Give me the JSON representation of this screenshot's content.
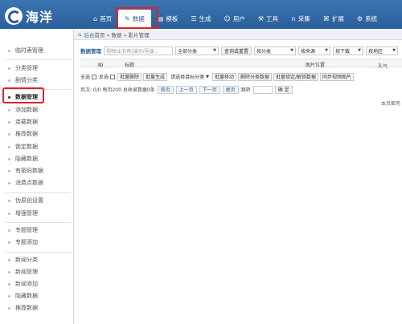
{
  "brand": {
    "name": "海洋"
  },
  "topnav": [
    {
      "label": "首页",
      "icon": "home-icon",
      "glyph": "⌂"
    },
    {
      "label": "数据",
      "icon": "edit-icon",
      "glyph": "✎"
    },
    {
      "label": "模板",
      "icon": "file-icon",
      "glyph": "▤"
    },
    {
      "label": "生成",
      "icon": "list-icon",
      "glyph": "☰"
    },
    {
      "label": "用户",
      "icon": "user-icon",
      "glyph": "☺"
    },
    {
      "label": "工具",
      "icon": "wrench-icon",
      "glyph": "⚒"
    },
    {
      "label": "采集",
      "icon": "magnet-icon",
      "glyph": "∩"
    },
    {
      "label": "扩展",
      "icon": "sitemap-icon",
      "glyph": "⌘"
    },
    {
      "label": "系统",
      "icon": "gear-icon",
      "glyph": "⚙"
    }
  ],
  "sidebar": [
    "临时表管理",
    "分类管理",
    "剧情分类",
    "数据管理",
    "添加数据",
    "连载数据",
    "推荐数据",
    "锁定数据",
    "隐藏数据",
    "有密码数据",
    "消费点数据",
    "伪原创设置",
    "增强管理",
    "专题管理",
    "专题添加",
    "新闻分类",
    "新闻管理",
    "新闻添加",
    "隐藏数据",
    "推荐数据"
  ],
  "breadcrumb": {
    "text": "后台首页 » 数据 » 影片管理"
  },
  "search": {
    "title": "数据管理",
    "placeholder": "视频id/名称/演员/导演..",
    "category": "全部分类",
    "query_button": "查询或重置",
    "sort": "按分类",
    "source": "按来源",
    "download": "按下载",
    "region": "按地区"
  },
  "table": {
    "col_id": "ID",
    "col_title": "标题",
    "col_image": "图片位置",
    "col_popularity": "人气",
    "sort_glyph": "⇅"
  },
  "actions": {
    "select_all": "全选",
    "invert": "反选",
    "batch_delete": "批量删除",
    "batch_generate": "批量生成",
    "move_target": "请选择目标分类",
    "batch_move": "批量移动",
    "delete_category": "删除分类数据",
    "batch_lock": "批量锁定/解锁数据",
    "sync_images": "同步视频图片"
  },
  "pager": {
    "info": "页次: 0/0 每页200 总收录数据0条",
    "first": "首页",
    "prev": "上一页",
    "next": "下一页",
    "last": "尾页",
    "jump_label": "跳转",
    "confirm": "确 定"
  },
  "footer": {
    "text": "本页面用"
  }
}
